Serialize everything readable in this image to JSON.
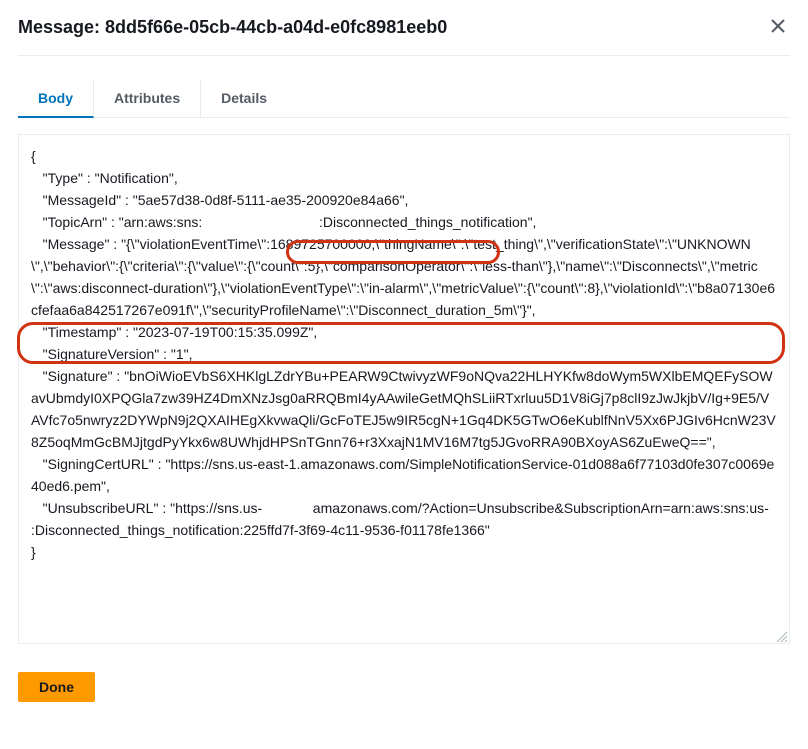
{
  "modal": {
    "title_prefix": "Message: ",
    "message_id": "8dd5f66e-05cb-44cb-a04d-e0fc8981eeb0"
  },
  "tabs": {
    "body": "Body",
    "attributes": "Attributes",
    "details": "Details"
  },
  "message_body": "{\n   \"Type\" : \"Notification\",\n   \"MessageId\" : \"5ae57d38-0d8f-5111-ae35-200920e84a66\",\n   \"TopicArn\" : \"arn:aws:sns:                              :Disconnected_things_notification\",\n   \"Message\" : \"{\\\"violationEventTime\\\":1689725700000,\\\"thingName\\\":\\\"test_thing\\\",\\\"verificationState\\\":\\\"UNKNOWN\\\",\\\"behavior\\\":{\\\"criteria\\\":{\\\"value\\\":{\\\"count\\\":5},\\\"comparisonOperator\\\":\\\"less-than\\\"},\\\"name\\\":\\\"Disconnects\\\",\\\"metric\\\":\\\"aws:disconnect-duration\\\"},\\\"violationEventType\\\":\\\"in-alarm\\\",\\\"metricValue\\\":{\\\"count\\\":8},\\\"violationId\\\":\\\"b8a07130e6cfefaa6a842517267e091f\\\",\\\"securityProfileName\\\":\\\"Disconnect_duration_5m\\\"}\",\n   \"Timestamp\" : \"2023-07-19T00:15:35.099Z\",\n   \"SignatureVersion\" : \"1\",\n   \"Signature\" : \"bnOiWioEVbS6XHKlgLZdrYBu+PEARW9CtwivyzWF9oNQva22HLHYKfw8doWym5WXlbEMQEFySOWavUbmdyI0XPQGla7zw39HZ4DmXNzJsg0aRRQBmI4yAAwileGetMQhSLiiRTxrluu5D1V8iGj7p8clI9zJwJkjbV/Ig+9E5/VAVfc7o5nwryz2DYWpN9j2QXAIHEgXkvwaQli/GcFoTEJ5w9IR5cgN+1Gq4DK5GTwO6eKublfNnV5Xx6PJGIv6HcnW23V8Z5oqMmGcBMJjtgdPyYkx6w8UWhjdHPSnTGnn76+r3XxajN1MV16M7tg5JGvoRRA90BXoyAS6ZuEweQ==\",\n   \"SigningCertURL\" : \"https://sns.us-east-1.amazonaws.com/SimpleNotificationService-01d088a6f77103d0fe307c0069e40ed6.pem\",\n   \"UnsubscribeURL\" : \"https://sns.us-             amazonaws.com/?Action=Unsubscribe&SubscriptionArn=arn:aws:sns:us-                             :Disconnected_things_notification:225ffd7f-3f69-4c11-9536-f01178fe1366\"\n}",
  "footer": {
    "done": "Done"
  }
}
